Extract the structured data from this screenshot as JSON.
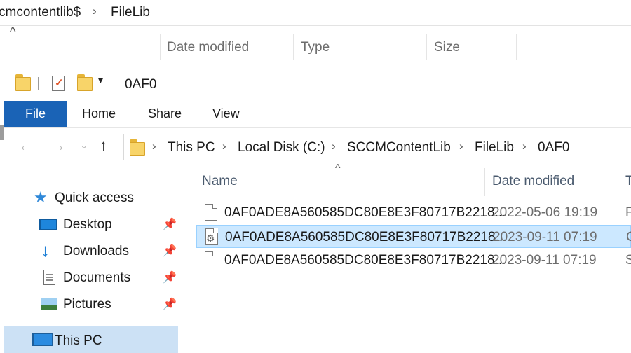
{
  "background_window": {
    "breadcrumb": [
      "cmcontentlib$",
      "FileLib"
    ],
    "columns": [
      "Date modified",
      "Type",
      "Size"
    ]
  },
  "title": "0AF0",
  "ribbon": {
    "tabs": [
      "File",
      "Home",
      "Share",
      "View"
    ],
    "active_color": "#1a63b6"
  },
  "address_bar": {
    "path": [
      "This PC",
      "Local Disk (C:)",
      "SCCMContentLib",
      "FileLib",
      "0AF0"
    ]
  },
  "nav_pane": {
    "quick_access": "Quick access",
    "items": [
      {
        "label": "Desktop",
        "icon": "desktop-icon",
        "pinned": true
      },
      {
        "label": "Downloads",
        "icon": "download-arrow-icon",
        "pinned": true
      },
      {
        "label": "Documents",
        "icon": "documents-icon",
        "pinned": true
      },
      {
        "label": "Pictures",
        "icon": "pictures-icon",
        "pinned": true
      }
    ],
    "this_pc": "This PC"
  },
  "file_list": {
    "columns": [
      "Name",
      "Date modified",
      "T"
    ],
    "rows": [
      {
        "name": "0AF0ADE8A560585DC80E8E3F80717B2218...",
        "date": "2022-05-06 19:19",
        "type": "F",
        "icon": "file-icon",
        "selected": false
      },
      {
        "name": "0AF0ADE8A560585DC80E8E3F80717B2218...",
        "date": "2023-09-11 07:19",
        "type": "C",
        "icon": "settings-file-icon",
        "selected": true
      },
      {
        "name": "0AF0ADE8A560585DC80E8E3F80717B2218...",
        "date": "2023-09-11 07:19",
        "type": "S",
        "icon": "file-icon",
        "selected": false
      }
    ],
    "selection_color": "#cce8ff"
  }
}
